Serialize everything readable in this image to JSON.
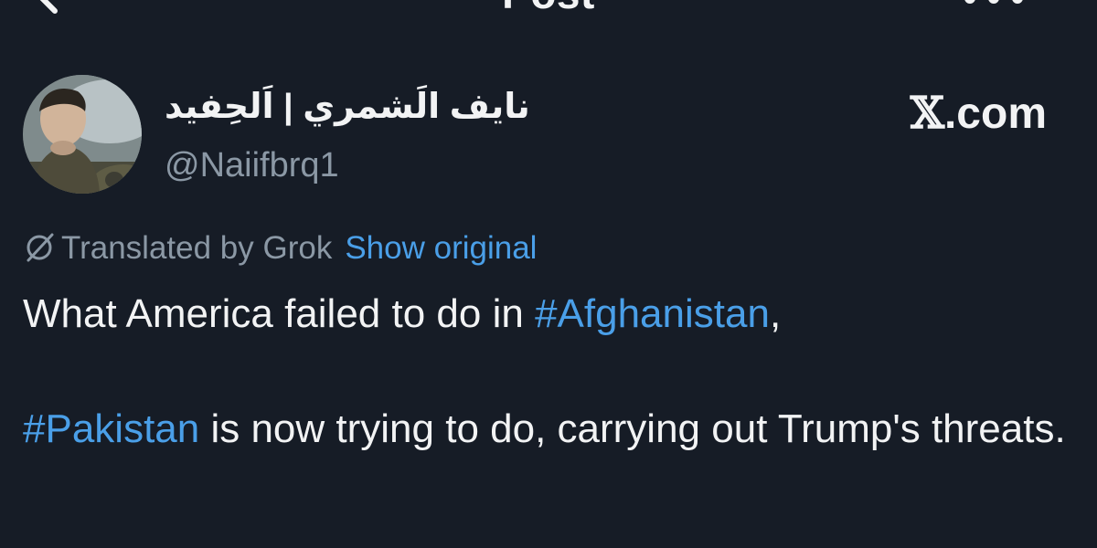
{
  "header": {
    "title": "Post",
    "back_icon": "arrow-left-icon",
    "more_icon": "more-dots-icon"
  },
  "author": {
    "display_name": "نايف الَشمري | اَلحِفيد",
    "handle": "@Naiifbrq1",
    "avatar_icon": "avatar-photo"
  },
  "watermark": {
    "x_glyph": "𝕏",
    "domain": ".com"
  },
  "translation": {
    "icon": "translate-slash-icon",
    "label": "Translated by Grok",
    "link": "Show original"
  },
  "tweet": {
    "line1_prefix": "What America failed to do in ",
    "hashtag1": "#Afghanistan",
    "line1_suffix": ",",
    "hashtag2": "#Pakistan",
    "line2_suffix": " is now trying to do, carrying out Trump's threats."
  },
  "colors": {
    "background": "#161c26",
    "text": "#f2f3f4",
    "muted": "#8b98a5",
    "link": "#4a9fe8"
  }
}
